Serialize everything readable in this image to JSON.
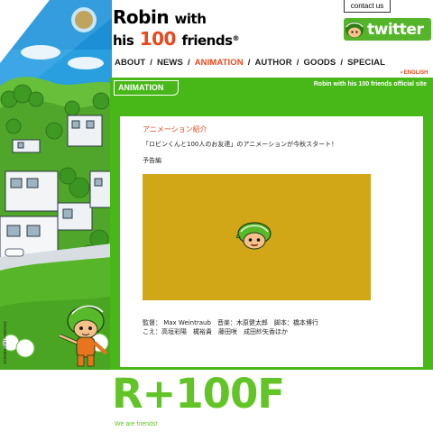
{
  "header": {
    "logo_line1": "Robin",
    "logo_line1_small": "with",
    "logo_line2_prefix": "his",
    "logo_line2_num": "100",
    "logo_line2_suffix": "friends",
    "logo_reg": "®",
    "contact_label": "contact us",
    "twitter_label": "twitter"
  },
  "nav": {
    "items": [
      "ABOUT",
      "NEWS",
      "ANIMATION",
      "AUTHOR",
      "GOODS",
      "SPECIAL"
    ],
    "active_index": 2,
    "separator": "/",
    "english_link": "• ENGLISH"
  },
  "panel": {
    "tab_label": "ANIMATION",
    "site_caption": "Robin with his 100 friends official site",
    "section_title": "アニメーション紹介",
    "description": "「ロビンくんと100人のお友達」のアニメーションが今秋スタート！",
    "trailer_label": "予告編",
    "credits_line1": "監督： Max Weintraub　音楽：木原健太郎　脚本：橋本博行",
    "credits_line2": "こえ：高垣彩陽　梶裕貴　藤田咲　成田紗矢香ほか"
  },
  "footer": {
    "logo_text": "R+100F",
    "tagline": "We are friends!"
  },
  "sidebar": {
    "copyright": "©ROBIN+100FRIENDS"
  },
  "colors": {
    "brand_green": "#48b818",
    "accent_orange": "#e8471b",
    "video_gold": "#d2a717",
    "footer_green": "#62c426"
  },
  "icons": {
    "twitter": "bird-icon",
    "play_character": "robin-character-icon"
  }
}
